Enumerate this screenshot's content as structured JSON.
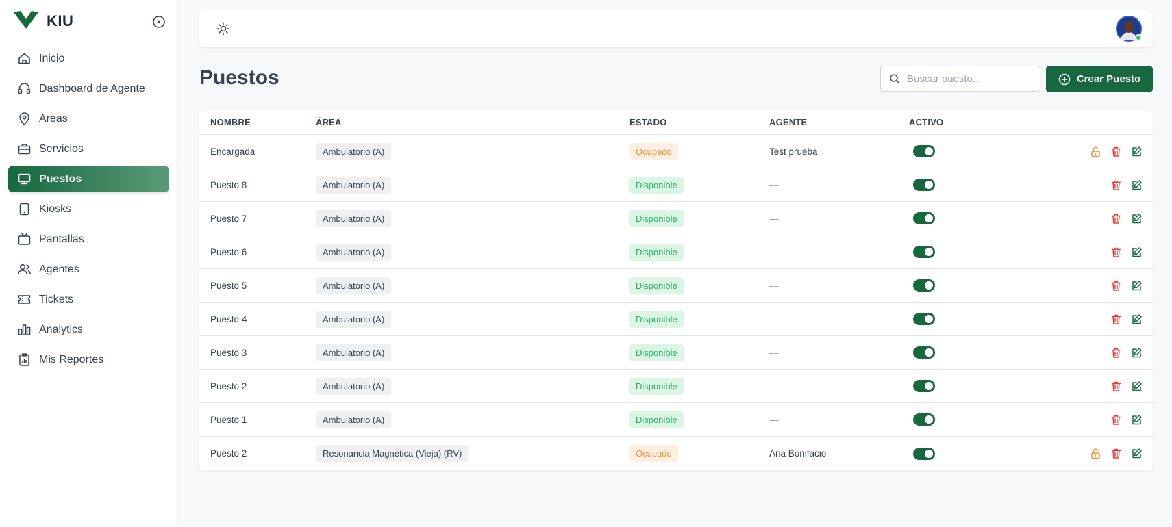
{
  "brand": {
    "name": "KIU",
    "color": "#17683f"
  },
  "sidebar": {
    "items": [
      {
        "label": "Inicio",
        "icon": "home-icon",
        "active": false
      },
      {
        "label": "Dashboard de Agente",
        "icon": "headset-icon",
        "active": false
      },
      {
        "label": "Areas",
        "icon": "map-pin-icon",
        "active": false
      },
      {
        "label": "Servicios",
        "icon": "briefcase-icon",
        "active": false
      },
      {
        "label": "Puestos",
        "icon": "monitor-icon",
        "active": true
      },
      {
        "label": "Kiosks",
        "icon": "tablet-icon",
        "active": false
      },
      {
        "label": "Pantallas",
        "icon": "tv-icon",
        "active": false
      },
      {
        "label": "Agentes",
        "icon": "users-icon",
        "active": false
      },
      {
        "label": "Tickets",
        "icon": "ticket-icon",
        "active": false
      },
      {
        "label": "Analytics",
        "icon": "bar-chart-icon",
        "active": false
      },
      {
        "label": "Mis Reportes",
        "icon": "clipboard-icon",
        "active": false
      }
    ]
  },
  "header": {
    "title": "Puestos",
    "search_placeholder": "Buscar puesto...",
    "create_label": "Crear Puesto"
  },
  "table": {
    "columns": [
      "NOMBRE",
      "ÁREA",
      "ESTADO",
      "AGENTE",
      "ACTIVO"
    ],
    "rows": [
      {
        "nombre": "Encargada",
        "area": "Ambulatorio (A)",
        "estado": "Ocupado",
        "agente": "Test prueba",
        "activo": true,
        "unlock": true
      },
      {
        "nombre": "Puesto 8",
        "area": "Ambulatorio (A)",
        "estado": "Disponible",
        "agente": "—",
        "activo": true,
        "unlock": false
      },
      {
        "nombre": "Puesto 7",
        "area": "Ambulatorio (A)",
        "estado": "Disponible",
        "agente": "—",
        "activo": true,
        "unlock": false
      },
      {
        "nombre": "Puesto 6",
        "area": "Ambulatorio (A)",
        "estado": "Disponible",
        "agente": "—",
        "activo": true,
        "unlock": false
      },
      {
        "nombre": "Puesto 5",
        "area": "Ambulatorio (A)",
        "estado": "Disponible",
        "agente": "—",
        "activo": true,
        "unlock": false
      },
      {
        "nombre": "Puesto 4",
        "area": "Ambulatorio (A)",
        "estado": "Disponible",
        "agente": "—",
        "activo": true,
        "unlock": false
      },
      {
        "nombre": "Puesto 3",
        "area": "Ambulatorio (A)",
        "estado": "Disponible",
        "agente": "—",
        "activo": true,
        "unlock": false
      },
      {
        "nombre": "Puesto 2",
        "area": "Ambulatorio (A)",
        "estado": "Disponible",
        "agente": "—",
        "activo": true,
        "unlock": false
      },
      {
        "nombre": "Puesto 1",
        "area": "Ambulatorio (A)",
        "estado": "Disponible",
        "agente": "—",
        "activo": true,
        "unlock": false
      },
      {
        "nombre": "Puesto 2",
        "area": "Resonancia Magnética (Vieja) (RV)",
        "estado": "Ocupado",
        "agente": "Ana Bonifacio",
        "activo": true,
        "unlock": true
      }
    ]
  },
  "colors": {
    "primary": "#17683f",
    "ocupado_text": "#f0913b",
    "disponible_text": "#23b15f",
    "delete": "#e0403c",
    "online": "#22c55e"
  }
}
